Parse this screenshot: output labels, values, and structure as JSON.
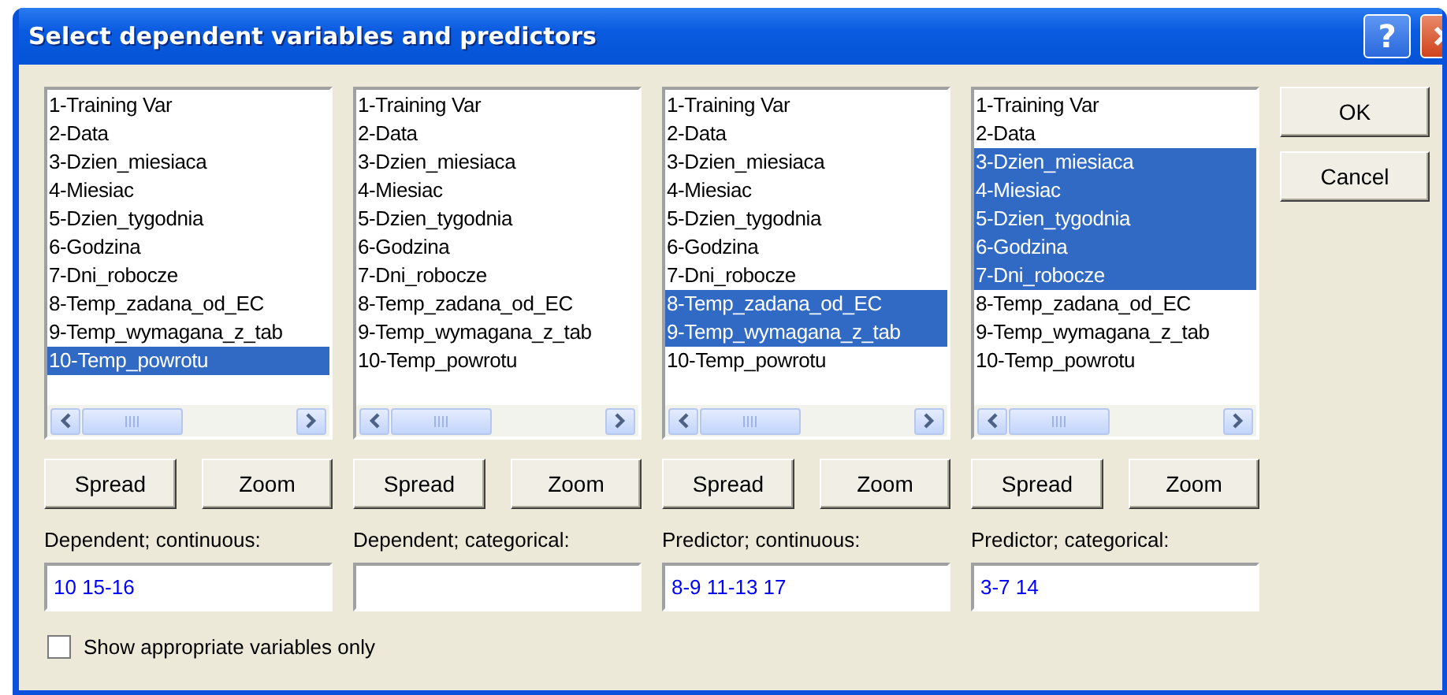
{
  "window": {
    "title": "Select dependent variables and predictors",
    "help": "?"
  },
  "lists": [
    {
      "items": [
        {
          "label": "1-Training Var",
          "selected": false
        },
        {
          "label": "2-Data",
          "selected": false
        },
        {
          "label": "3-Dzien_miesiaca",
          "selected": false
        },
        {
          "label": "4-Miesiac",
          "selected": false
        },
        {
          "label": "5-Dzien_tygodnia",
          "selected": false
        },
        {
          "label": "6-Godzina",
          "selected": false
        },
        {
          "label": "7-Dni_robocze",
          "selected": false
        },
        {
          "label": "8-Temp_zadana_od_EC",
          "selected": false
        },
        {
          "label": "9-Temp_wymagana_z_tab",
          "selected": false
        },
        {
          "label": "10-Temp_powrotu",
          "selected": true
        }
      ],
      "spread": "Spread",
      "zoom": "Zoom",
      "label": "Dependent; continuous:",
      "value": "10 15-16"
    },
    {
      "items": [
        {
          "label": "1-Training Var",
          "selected": false
        },
        {
          "label": "2-Data",
          "selected": false
        },
        {
          "label": "3-Dzien_miesiaca",
          "selected": false
        },
        {
          "label": "4-Miesiac",
          "selected": false
        },
        {
          "label": "5-Dzien_tygodnia",
          "selected": false
        },
        {
          "label": "6-Godzina",
          "selected": false
        },
        {
          "label": "7-Dni_robocze",
          "selected": false
        },
        {
          "label": "8-Temp_zadana_od_EC",
          "selected": false
        },
        {
          "label": "9-Temp_wymagana_z_tab",
          "selected": false
        },
        {
          "label": "10-Temp_powrotu",
          "selected": false
        }
      ],
      "spread": "Spread",
      "zoom": "Zoom",
      "label": "Dependent; categorical:"
    },
    {
      "items": [
        {
          "label": "1-Training Var",
          "selected": false
        },
        {
          "label": "2-Data",
          "selected": false
        },
        {
          "label": "3-Dzien_miesiaca",
          "selected": false
        },
        {
          "label": "4-Miesiac",
          "selected": false
        },
        {
          "label": "5-Dzien_tygodnia",
          "selected": false
        },
        {
          "label": "6-Godzina",
          "selected": false
        },
        {
          "label": "7-Dni_robocze",
          "selected": false
        },
        {
          "label": "8-Temp_zadana_od_EC",
          "selected": true
        },
        {
          "label": "9-Temp_wymagana_z_tab",
          "selected": true
        },
        {
          "label": "10-Temp_powrotu",
          "selected": false
        }
      ],
      "spread": "Spread",
      "zoom": "Zoom",
      "label": "Predictor; continuous:",
      "value": "8-9 11-13 17"
    },
    {
      "items": [
        {
          "label": "1-Training Var",
          "selected": false
        },
        {
          "label": "2-Data",
          "selected": false
        },
        {
          "label": "3-Dzien_miesiaca",
          "selected": true
        },
        {
          "label": "4-Miesiac",
          "selected": true
        },
        {
          "label": "5-Dzien_tygodnia",
          "selected": true
        },
        {
          "label": "6-Godzina",
          "selected": true
        },
        {
          "label": "7-Dni_robocze",
          "selected": true
        },
        {
          "label": "8-Temp_zadana_od_EC",
          "selected": false
        },
        {
          "label": "9-Temp_wymagana_z_tab",
          "selected": false
        },
        {
          "label": "10-Temp_powrotu",
          "selected": false
        }
      ],
      "spread": "Spread",
      "zoom": "Zoom",
      "label": "Predictor; categorical:",
      "value": "3-7 14"
    }
  ],
  "buttons": [
    "OK",
    "Cancel"
  ],
  "checkbox": {
    "label": "Show appropriate variables only",
    "checked": false
  }
}
